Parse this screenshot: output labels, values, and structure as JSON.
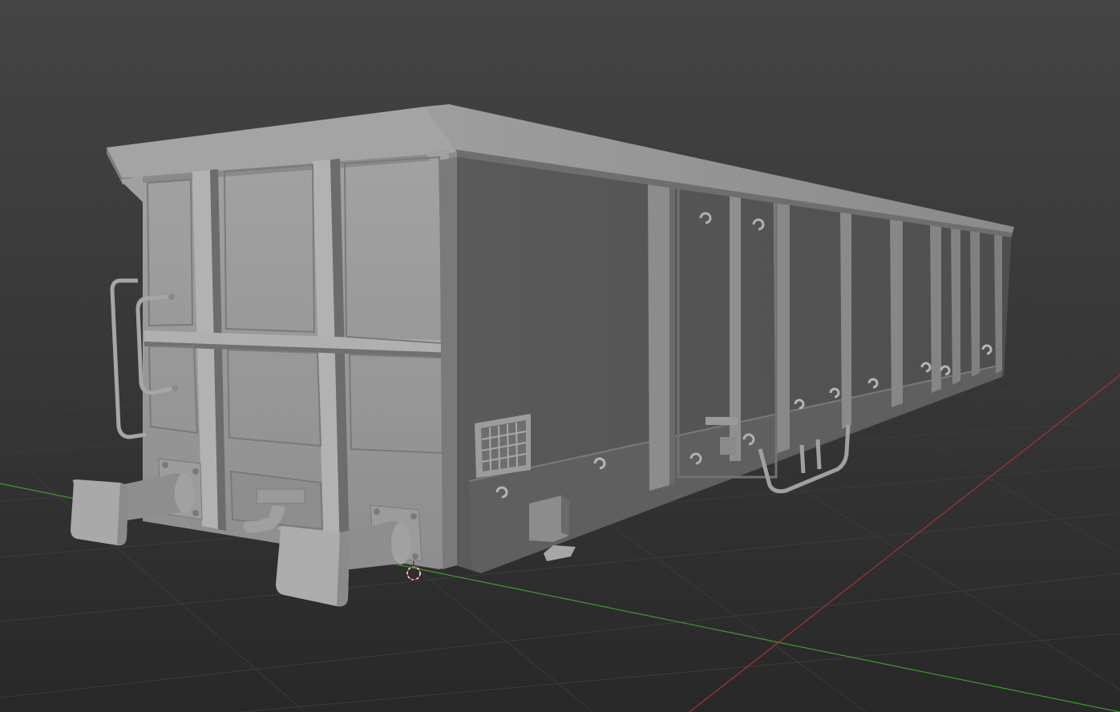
{
  "app": {
    "name": "",
    "view": "3D Viewport",
    "shading": "solid"
  },
  "viewport": {
    "background_top_color": "#424242",
    "background_bottom_color": "#2a2a2a",
    "grid_color": "#3a3a3a",
    "x_axis_color": "#a83232",
    "y_axis_color": "#3f9b2e",
    "model_color": "#9a9a9a",
    "model_shadow_color": "#6b6b6b",
    "model_dark_side_color": "#555555"
  },
  "scene": {
    "object": "open-top-freight-wagon",
    "cursor_icon": "3d-cursor-icon"
  }
}
